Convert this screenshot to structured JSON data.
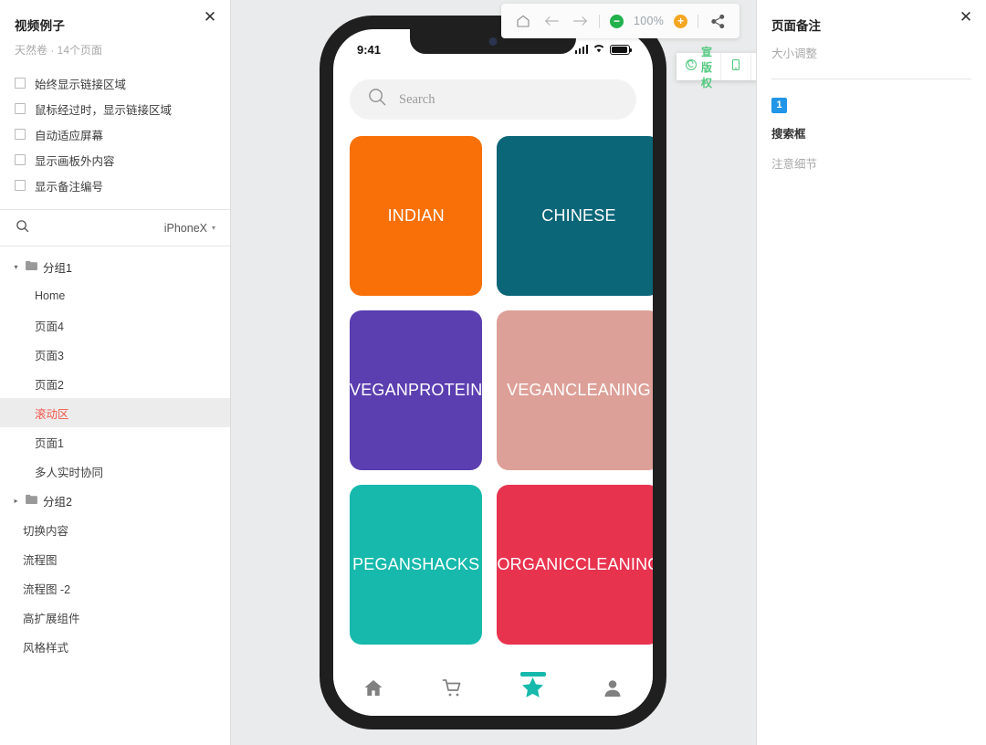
{
  "left_panel": {
    "close_label": "✕",
    "title": "视频例子",
    "subtitle": "天然卷 · 14个页面",
    "checkboxes": [
      {
        "label": "始终显示链接区域",
        "checked": false
      },
      {
        "label": "鼠标经过时，显示链接区域",
        "checked": false
      },
      {
        "label": "自动适应屏幕",
        "checked": false
      },
      {
        "label": "显示画板外内容",
        "checked": false
      },
      {
        "label": "显示备注编号",
        "checked": false
      }
    ],
    "search_placeholder": "",
    "device": "iPhoneX",
    "tree": [
      {
        "type": "group",
        "label": "分组1",
        "expanded": true,
        "twisty": "▾"
      },
      {
        "type": "item",
        "label": "Home",
        "selected": false
      },
      {
        "type": "item",
        "label": "页面4",
        "selected": false
      },
      {
        "type": "item",
        "label": "页面3",
        "selected": false
      },
      {
        "type": "item",
        "label": "页面2",
        "selected": false
      },
      {
        "type": "item",
        "label": "滚动区",
        "selected": true
      },
      {
        "type": "item",
        "label": "页面1",
        "selected": false
      },
      {
        "type": "item",
        "label": "多人实时协同",
        "selected": false
      },
      {
        "type": "group",
        "label": "分组2",
        "expanded": false,
        "twisty": "▸"
      },
      {
        "type": "flat",
        "label": "切换内容",
        "selected": false
      },
      {
        "type": "flat",
        "label": "流程图",
        "selected": false
      },
      {
        "type": "flat",
        "label": "流程图 -2",
        "selected": false
      },
      {
        "type": "flat",
        "label": "高扩展组件",
        "selected": false
      },
      {
        "type": "flat",
        "label": "风格样式",
        "selected": false
      }
    ]
  },
  "toolbar": {
    "home_icon": "home-icon",
    "back_icon": "arrow-left-icon",
    "forward_icon": "arrow-right-icon",
    "zoom_out_icon": "minus-circle-icon",
    "zoom_out_glyph": "−",
    "zoom_level": "100%",
    "zoom_in_icon": "plus-circle-icon",
    "zoom_in_glyph": "+",
    "share_icon": "share-icon",
    "zoom_out_color": "#22b14c",
    "zoom_in_color": "#f5a623"
  },
  "green_toolbar": {
    "accent": "#52c97f",
    "items": [
      {
        "name": "copyright-button",
        "icon": "copyright-icon",
        "label": "宣版权"
      },
      {
        "name": "device-preview-button",
        "icon": "mobile-icon",
        "label": ""
      },
      {
        "name": "fullscreen-button",
        "icon": "expand-icon",
        "label": ""
      },
      {
        "name": "save-button",
        "icon": "save-icon",
        "label": ""
      },
      {
        "name": "export-button",
        "icon": "export-icon",
        "label": ""
      },
      {
        "name": "settings-button",
        "icon": "gear-icon",
        "label": ""
      }
    ]
  },
  "phone": {
    "status_time": "9:41",
    "search_placeholder": "Search",
    "tiles": [
      {
        "label": "INDIAN",
        "color": "#f87007"
      },
      {
        "label": "CHINESE",
        "color": "#0b6678"
      },
      {
        "label": "VEGAN\nPROTEIN",
        "color": "#5b3eb0"
      },
      {
        "label": "VEGAN\nCLEANING",
        "color": "#dda098"
      },
      {
        "label": "PEGAN\nSHACKS",
        "color": "#16b9ac"
      },
      {
        "label": "ORGANIC\nCLEANING",
        "color": "#e8334f"
      }
    ],
    "tabs": [
      {
        "icon": "home-icon",
        "active": false
      },
      {
        "icon": "cart-icon",
        "active": false
      },
      {
        "icon": "star-icon",
        "active": true
      },
      {
        "icon": "user-icon",
        "active": false
      }
    ],
    "active_color": "#16b9ac",
    "inactive_color": "#808080"
  },
  "right_panel": {
    "close_label": "✕",
    "title": "页面备注",
    "subtitle": "大小调整",
    "note_badge": "1",
    "note_badge_color": "#2196e8",
    "note_title": "搜索框",
    "note_detail": "注意细节"
  }
}
